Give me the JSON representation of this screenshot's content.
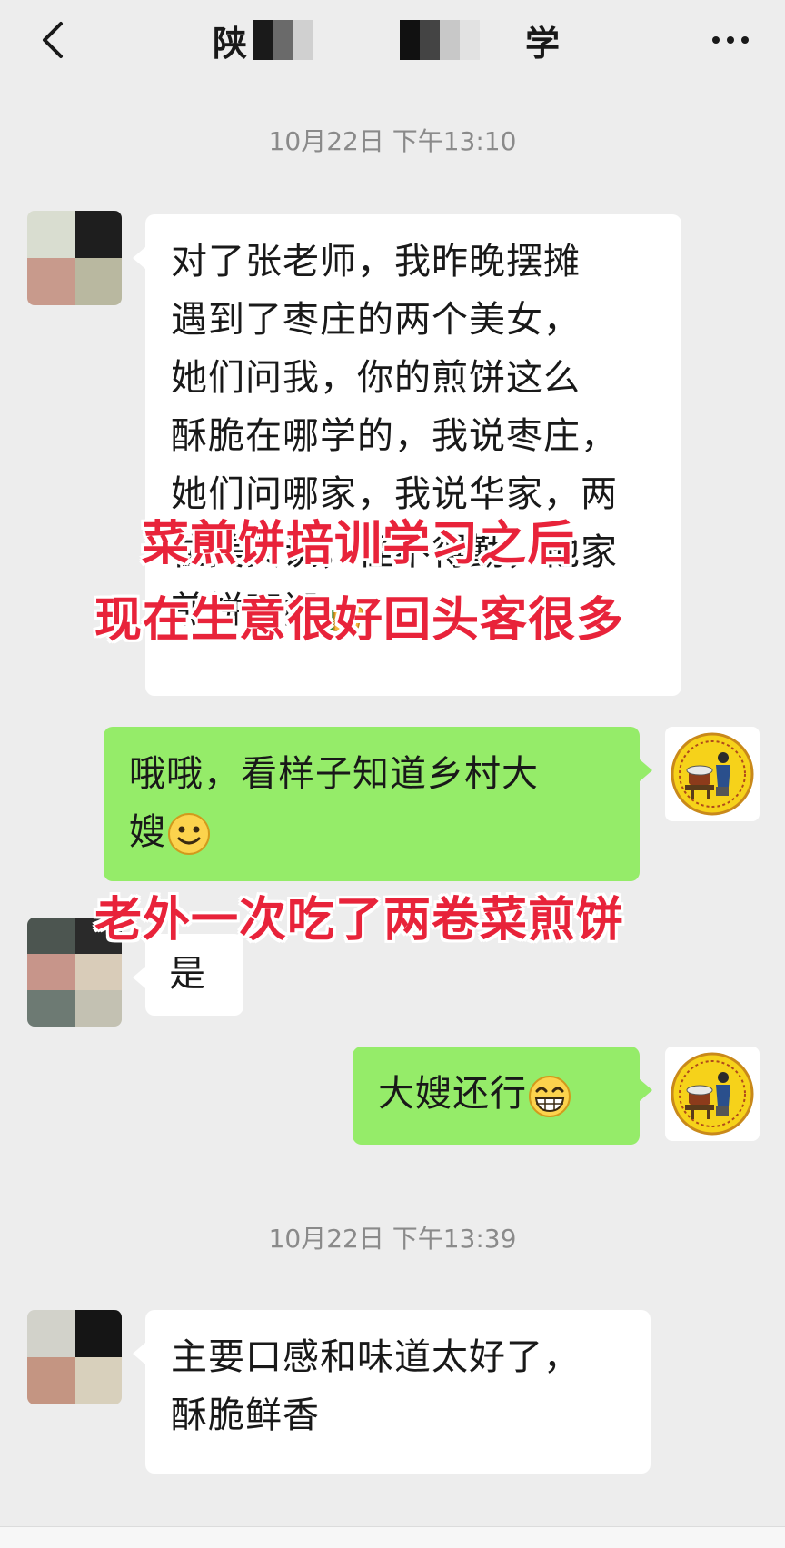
{
  "header": {
    "title_start": "陕",
    "title_end": "学",
    "back_icon": "chevron-left-icon",
    "more_icon": "more-dots-icon"
  },
  "messages": {
    "ts1": "10月22日 下午13:10",
    "ts2": "10月22日 下午13:39",
    "m1_lines": [
      "对了张老师，我昨晚摆摊",
      "遇到了枣庄的两个美女，",
      "她们问我，你的煎饼这么",
      "酥脆在哪学的，我说枣庄，",
      "她们问哪家，我说华家，两",
      "位美女说，怪不得勤，他家",
      "煎饼不闹"
    ],
    "m2_lines": [
      "哦哦，看样子知道乡村大",
      "嫂"
    ],
    "m3": "是",
    "m4": "大嫂还行",
    "m5_lines": [
      "主要口感和味道太好了，",
      "酥脆鲜香"
    ]
  },
  "overlays": {
    "o1": "菜煎饼培训学习之后",
    "o2": "现在生意很好回头客很多",
    "o3": "老外一次吃了两卷菜煎饼"
  },
  "colors": {
    "bg": "#ededed",
    "sent_bubble": "#95ec69",
    "received_bubble": "#ffffff",
    "overlay_text": "#e8233a"
  }
}
